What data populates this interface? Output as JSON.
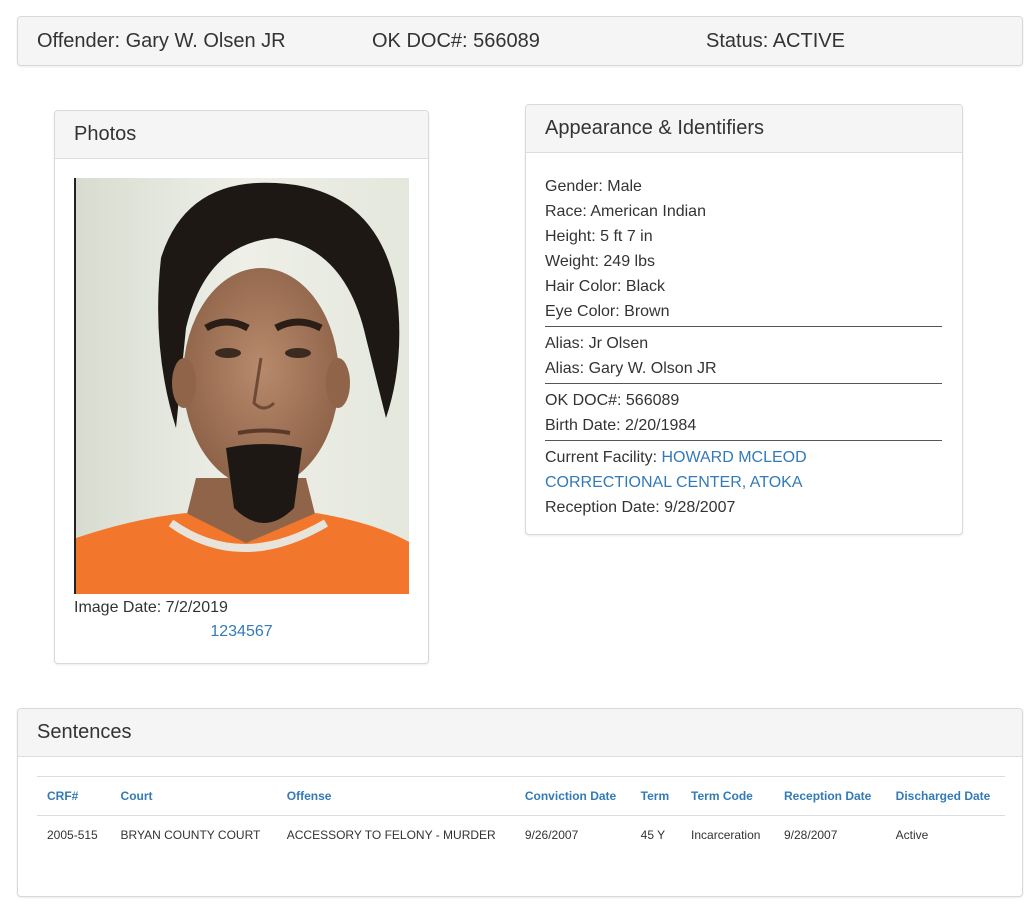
{
  "header": {
    "offender": "Offender: Gary W. Olsen JR",
    "okdoc": "OK DOC#: 566089",
    "status": "Status: ACTIVE"
  },
  "photos": {
    "title": "Photos",
    "image_date": "Image Date: 7/2/2019",
    "pages": [
      "1",
      "2",
      "3",
      "4",
      "5",
      "6",
      "7"
    ]
  },
  "appearance": {
    "title": "Appearance & Identifiers",
    "gender": "Gender: Male",
    "race": "Race: American Indian",
    "height": "Height: 5 ft 7 in",
    "weight": "Weight: 249 lbs",
    "hair": "Hair Color: Black",
    "eye": "Eye Color: Brown",
    "alias1": "Alias: Jr Olsen",
    "alias2": "Alias: Gary W. Olson JR",
    "okdoc": "OK DOC#: 566089",
    "birth": "Birth Date: 2/20/1984",
    "facility_label": "Current Facility: ",
    "facility_line1": "HOWARD MCLEOD",
    "facility_line2": "CORRECTIONAL CENTER, ATOKA",
    "reception": "Reception Date: 9/28/2007"
  },
  "sentences": {
    "title": "Sentences",
    "columns": [
      "CRF#",
      "Court",
      "Offense",
      "Conviction Date",
      "Term",
      "Term Code",
      "Reception Date",
      "Discharged Date"
    ],
    "rows": [
      [
        "2005-515",
        "BRYAN COUNTY COURT",
        "ACCESSORY TO FELONY - MURDER",
        "9/26/2007",
        "45 Y",
        "Incarceration",
        "9/28/2007",
        "Active"
      ]
    ]
  },
  "colors": {
    "link": "#337ab7",
    "uniform": "#f2772c"
  }
}
